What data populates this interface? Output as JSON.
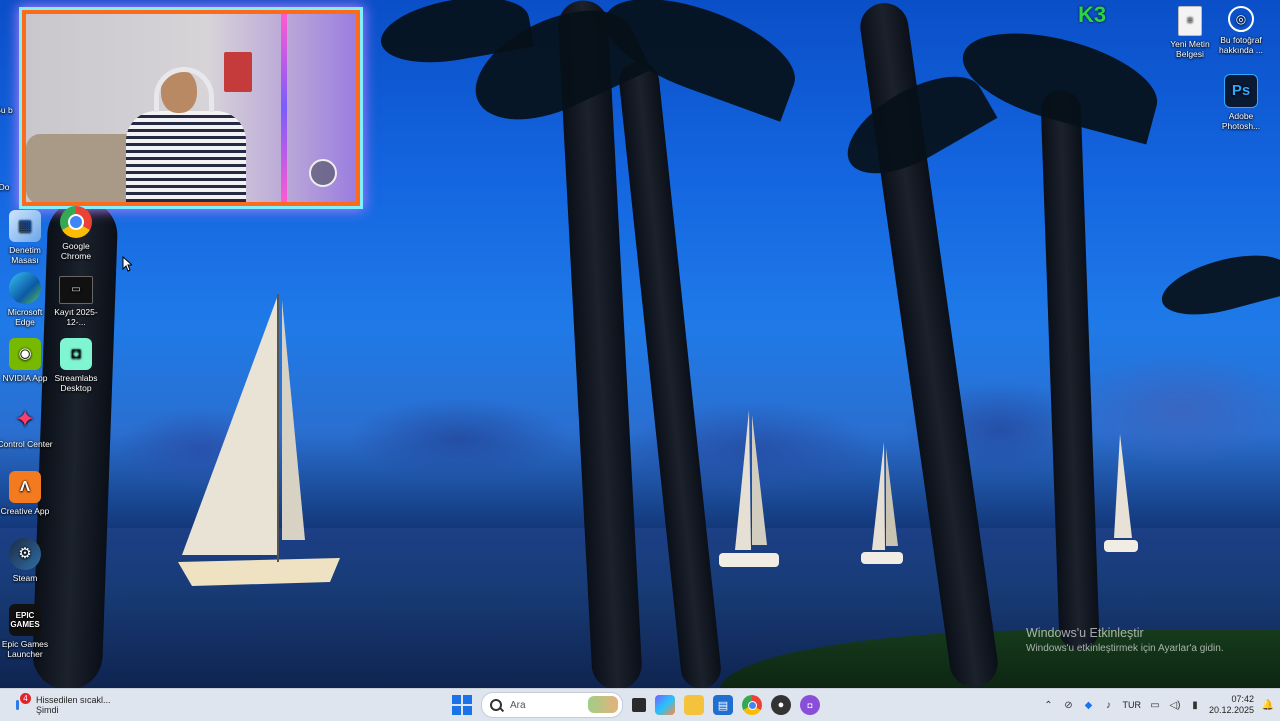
{
  "desktop": {
    "icons_left": [
      {
        "label": "Denetim Masası",
        "icon": "control-panel-icon"
      },
      {
        "label": "Google Chrome",
        "icon": "chrome-icon"
      },
      {
        "label": "Microsoft Edge",
        "icon": "edge-icon"
      },
      {
        "label": "Kayıt 2025-12-...",
        "icon": "video-file-icon"
      },
      {
        "label": "NVIDIA App",
        "icon": "nvidia-icon"
      },
      {
        "label": "Streamlabs Desktop",
        "icon": "streamlabs-icon"
      },
      {
        "label": "Control Center",
        "icon": "control-center-icon"
      },
      {
        "label": "Creative App",
        "icon": "creative-app-icon"
      },
      {
        "label": "Steam",
        "icon": "steam-icon"
      },
      {
        "label": "Epic Games Launcher",
        "icon": "epic-games-icon"
      }
    ],
    "partial_labels": [
      "Bu b",
      "Do"
    ],
    "icons_right": [
      {
        "label": "Yeni Metin Belgesi",
        "icon": "text-document-icon"
      },
      {
        "label": "Bu fotoğraf hakkında ...",
        "icon": "info-camera-icon"
      },
      {
        "label": "Adobe Photosh...",
        "icon": "photoshop-icon"
      }
    ],
    "overlay_badge": "K3",
    "activation": {
      "title": "Windows'u Etkinleştir",
      "subtitle": "Windows'u etkinleştirmek için Ayarlar'a gidin."
    }
  },
  "taskbar": {
    "weather": {
      "line1": "Hissedilen sıcakl...",
      "line2": "Şimdi",
      "badge": "4"
    },
    "search_placeholder": "Ara",
    "pinned": [
      "task-view-icon",
      "copilot-icon",
      "file-explorer-icon",
      "microsoft-store-icon",
      "chrome-icon",
      "obs-icon",
      "streamlabs-icon"
    ],
    "tray": {
      "language": "TUR",
      "time": "07:42",
      "date": "20.12.2025"
    }
  },
  "colors": {
    "cam_border": "#ff6a1a",
    "cam_glow": "#7ef0ff",
    "start_blue": "#1a73e8",
    "taskbar_bg": "#dfe5ee"
  }
}
